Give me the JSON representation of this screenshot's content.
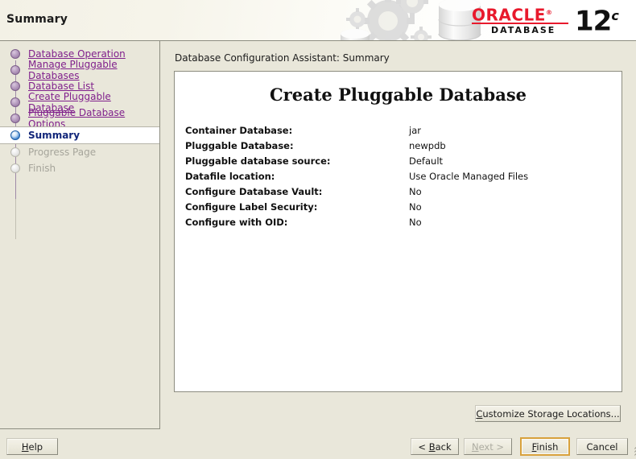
{
  "window": {
    "title": "Summary"
  },
  "branding": {
    "oracle_word": "ORACLE",
    "registered_mark": "®",
    "product_line": "DATABASE",
    "version_number": "12",
    "version_suffix": "c"
  },
  "sidebar": {
    "items": [
      {
        "label": "Database Operation",
        "state": "done"
      },
      {
        "label": "Manage Pluggable Databases",
        "state": "done"
      },
      {
        "label": "Database List",
        "state": "done"
      },
      {
        "label": "Create Pluggable Database",
        "state": "done"
      },
      {
        "label": "Pluggable Database Options",
        "state": "done"
      },
      {
        "label": "Summary",
        "state": "current"
      },
      {
        "label": "Progress Page",
        "state": "todo"
      },
      {
        "label": "Finish",
        "state": "todo"
      }
    ]
  },
  "main": {
    "breadcrumb": "Database Configuration Assistant: Summary",
    "panel_title": "Create Pluggable Database",
    "summary_rows": [
      {
        "label": "Container Database:",
        "value": "jar"
      },
      {
        "label": "Pluggable Database:",
        "value": "newpdb"
      },
      {
        "label": "Pluggable database source:",
        "value": "Default"
      },
      {
        "label": "Datafile location:",
        "value": "Use Oracle Managed Files"
      },
      {
        "label": "Configure Database Vault:",
        "value": "No"
      },
      {
        "label": "Configure Label Security:",
        "value": "No"
      },
      {
        "label": "Configure with OID:",
        "value": "No"
      }
    ]
  },
  "buttons": {
    "help": {
      "label": "Help",
      "mnemonic": "H",
      "enabled": true
    },
    "customize_storage": {
      "label": "Customize Storage Locations...",
      "mnemonic": "C",
      "enabled": true
    },
    "back": {
      "label": "< Back",
      "mnemonic": "B",
      "enabled": true
    },
    "next": {
      "label": "Next >",
      "mnemonic": "N",
      "enabled": false
    },
    "finish": {
      "label": "Finish",
      "mnemonic": "F",
      "enabled": true,
      "focused": true
    },
    "cancel": {
      "label": "Cancel",
      "mnemonic": "",
      "enabled": true
    }
  },
  "colors": {
    "background": "#e9e7da",
    "panel": "#ffffff",
    "link": "#80208c",
    "current_step": "#12267a",
    "disabled_text": "#a6a59b",
    "oracle_red": "#e8192c",
    "focus_ring": "#d8a13c",
    "border": "#8d8d80"
  }
}
